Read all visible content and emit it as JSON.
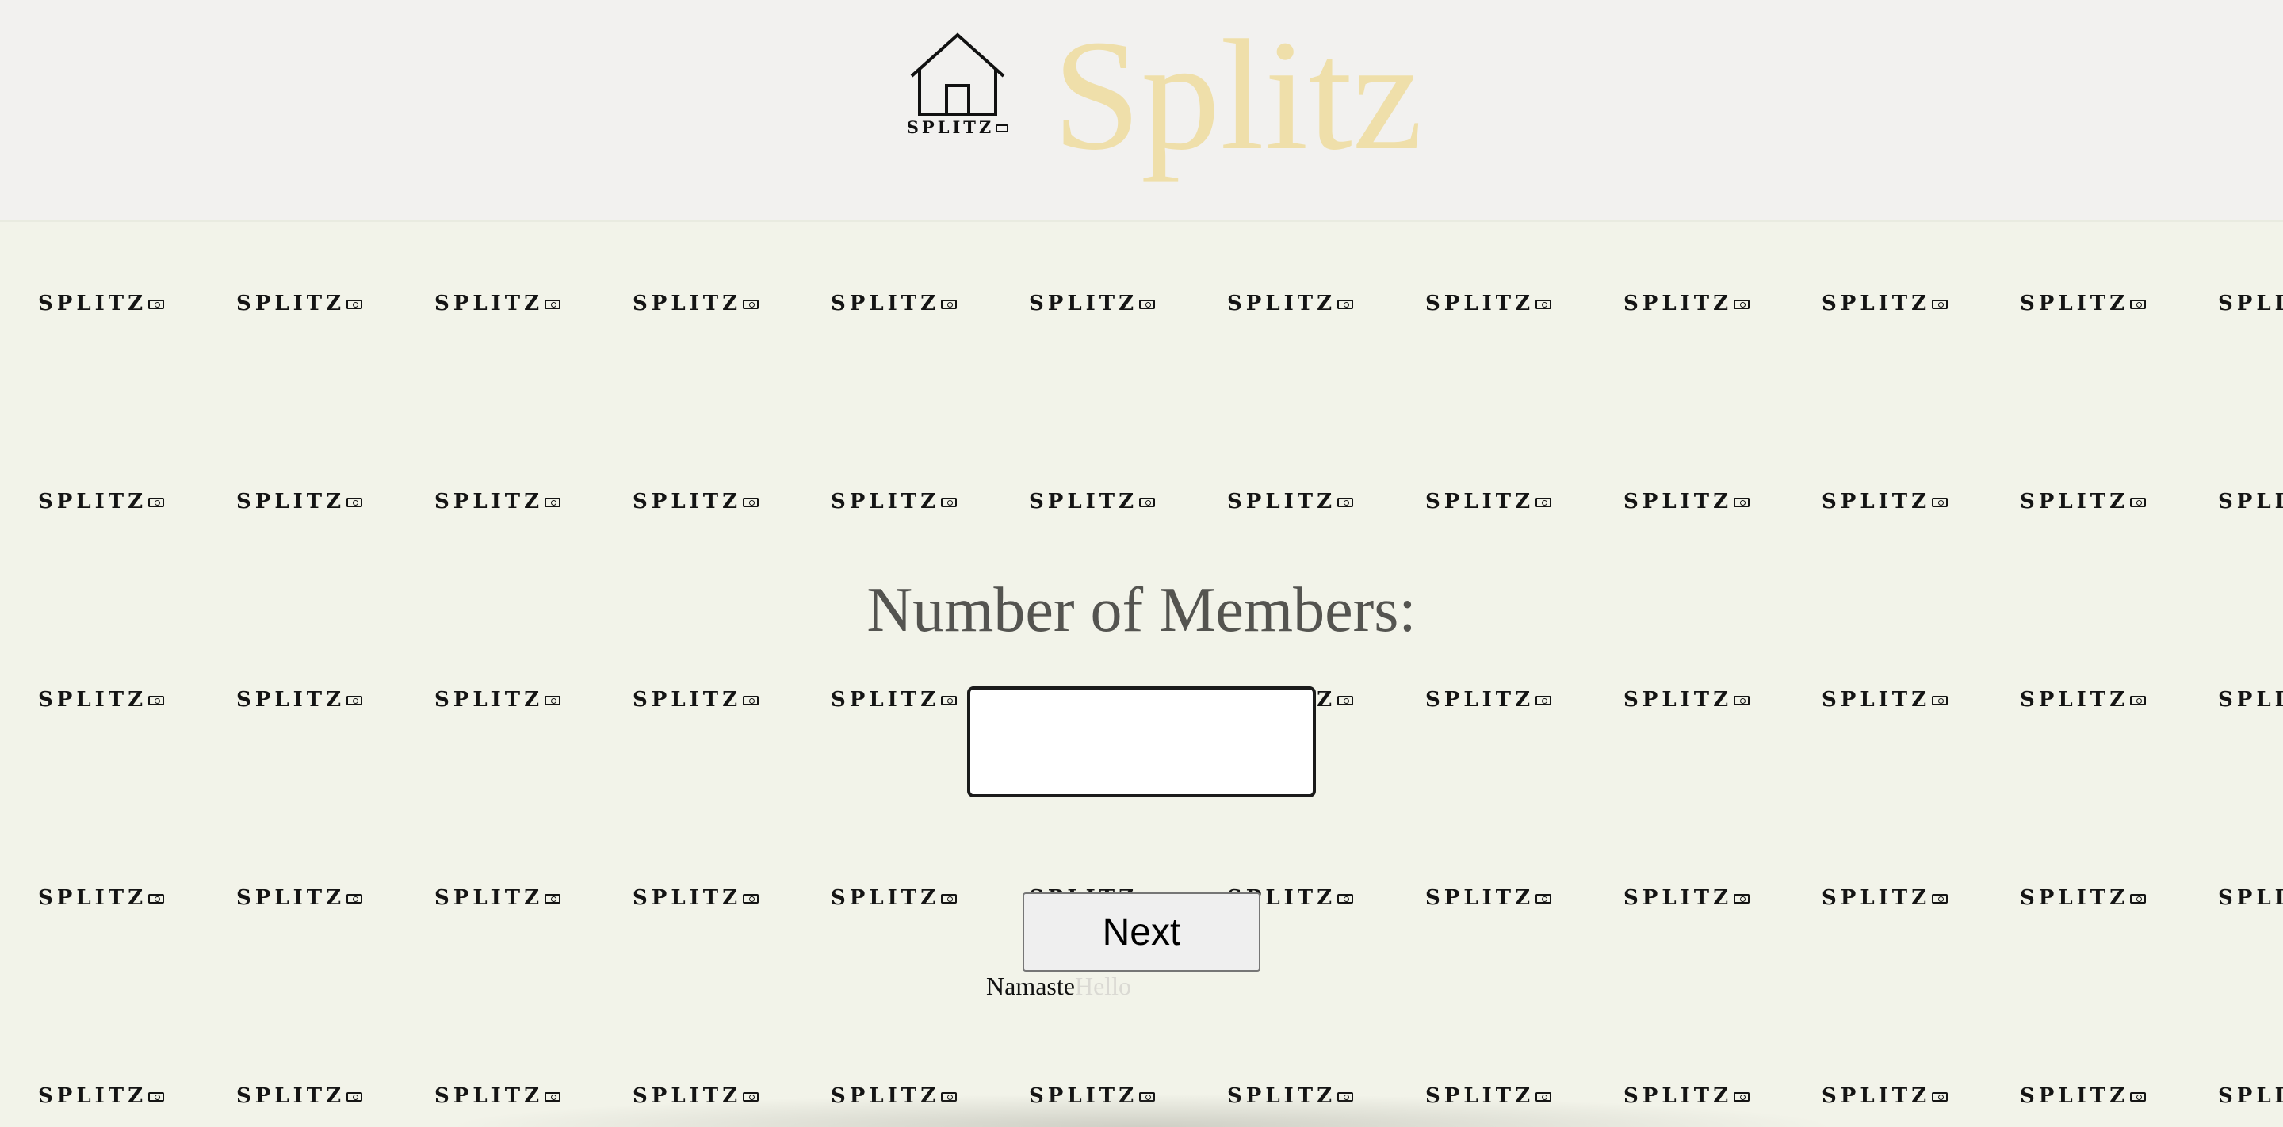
{
  "header": {
    "logo_text": "SPLITZ",
    "brand_title": "Splitz",
    "brand_color": "#efdfaa"
  },
  "background_pattern": {
    "label": "SPLITZ",
    "icon": "money-icon"
  },
  "form": {
    "title": "Number of Members:",
    "members_input_value": "",
    "next_label": "Next"
  },
  "greeting": {
    "primary": "Namaste",
    "secondary": "Hello"
  }
}
